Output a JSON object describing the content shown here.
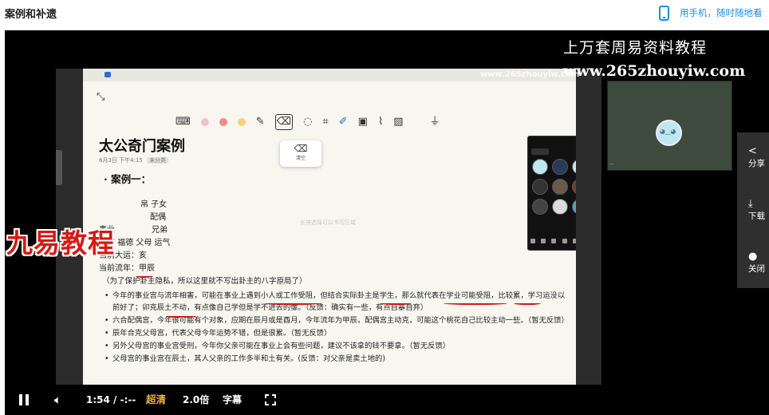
{
  "header": {
    "page_title": "案例和补遗",
    "mobile_link_label": "用手机，随时随地看"
  },
  "player": {
    "watermark_title": "上万套周易资料教程",
    "watermark_url": "www.265zhouyiw.com",
    "logo_watermark": "九易教程",
    "colors": {
      "ink": "#d01818",
      "quality_label": "#e8b53a",
      "link": "#1e8fe1"
    }
  },
  "note": {
    "toolbar_icons": [
      "keyboard-icon",
      "color-dot-pink",
      "color-dot-red",
      "color-dot-yellow",
      "pen-icon",
      "eraser-icon",
      "lasso-icon",
      "crop-icon",
      "highlighter-icon",
      "image-icon",
      "attach-icon",
      "pattern-icon",
      "mic-icon"
    ],
    "eraser_popup_label": "清空",
    "title": "太公奇门案例",
    "meta_date": "6月3日 下午4:15",
    "meta_tag": "未分类",
    "case_heading": "· 案例一：",
    "lines": {
      "l1": "帛 子女",
      "l2": "配偶",
      "l3": "事业",
      "l3b": "兄弟",
      "l4": "田宅 福德 父母 运气",
      "l5": "当前大运：亥",
      "l6": "当前流年：甲辰",
      "l7": "（为了保护卦主隐私，所以这里就不写出卦主的八字原局了）"
    },
    "faint_text": "长按选择可以书写区域",
    "bullets": [
      "今年的事业宫与流年相害，可能在事业上遇到小人或工作受阻，但结合实际卦主是学生，那么就代表在学业可能受阻，比较累，学习运没以前好了；卯克辰土不动，有点像自己学但是学不进去的像。（反馈：确实有一些，有点自暴自弃）",
      "六合配偶宫，今年很可能有个对象，应期在辰月或是酉月，今年流年为甲辰，配偶宫主动克，可能这个桃花自己比较主动一些。（暂无反馈）",
      "辰年合克父母宫，代表父母今年运势不错，但是很累。（暂无反馈）",
      "另外父母宫的事业宫受刑，今年你父亲可能在事业上会有些问题，建议不该拿的钱不要拿。（暂无反馈）",
      "父母宫的事业宫在辰土，其人父亲的工作多半和土有关。(反馈：对父亲是卖土地的)"
    ]
  },
  "side_panel": {
    "share_label": "分享",
    "download_label": "下载",
    "off_label": "关闭"
  },
  "controls": {
    "time": "1:54 / -:--",
    "quality": "超清",
    "speed": "2.0倍",
    "subtitles": "字幕"
  }
}
